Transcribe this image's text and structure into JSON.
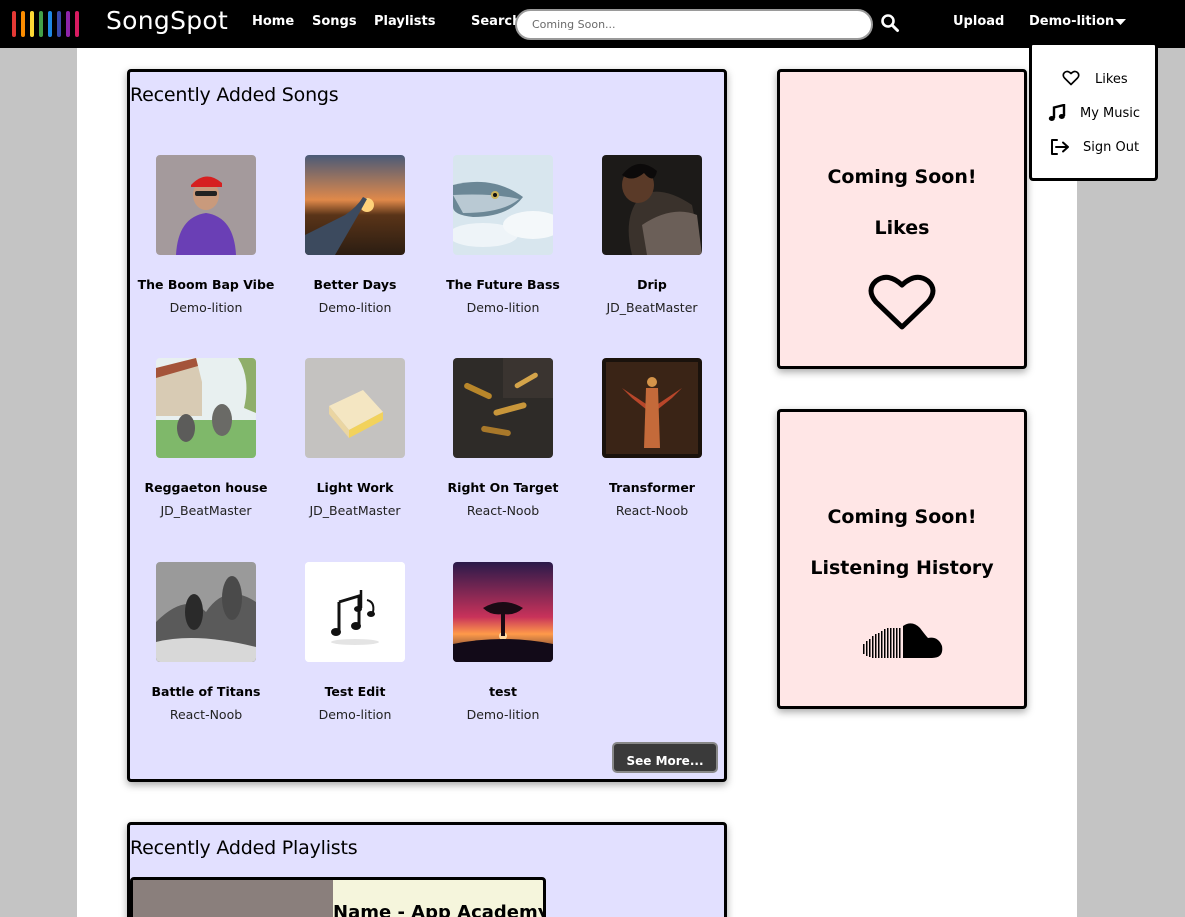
{
  "brand": {
    "name": "SongSpot",
    "logo_colors": [
      "#e53935",
      "#fb8c00",
      "#fdd835",
      "#43a047",
      "#1e88e5",
      "#3949ab",
      "#8e24aa",
      "#d81b60"
    ]
  },
  "nav": {
    "home": "Home",
    "songs": "Songs",
    "playlists": "Playlists",
    "search_label": "Search",
    "search_placeholder": "Coming Soon...",
    "upload": "Upload",
    "user": "Demo-lition"
  },
  "dropdown": {
    "items": [
      {
        "label": "Likes",
        "icon": "heart-icon"
      },
      {
        "label": "My Music",
        "icon": "music-note-icon"
      },
      {
        "label": "Sign Out",
        "icon": "sign-out-icon"
      }
    ]
  },
  "songs_panel": {
    "title": "Recently Added Songs",
    "see_more": "See More...",
    "songs": [
      {
        "title": "The Boom Bap Vibe",
        "artist": "Demo-lition"
      },
      {
        "title": "Better Days",
        "artist": "Demo-lition"
      },
      {
        "title": "The Future Bass",
        "artist": "Demo-lition"
      },
      {
        "title": "Drip",
        "artist": "JD_BeatMaster"
      },
      {
        "title": "Reggaeton house",
        "artist": "JD_BeatMaster"
      },
      {
        "title": "Light Work",
        "artist": "JD_BeatMaster"
      },
      {
        "title": "Right On Target",
        "artist": "React-Noob"
      },
      {
        "title": "Transformer",
        "artist": "React-Noob"
      },
      {
        "title": "Battle of Titans",
        "artist": "React-Noob"
      },
      {
        "title": "Test Edit",
        "artist": "Demo-lition"
      },
      {
        "title": "test",
        "artist": "Demo-lition"
      }
    ]
  },
  "playlists_panel": {
    "title": "Recently Added Playlists",
    "playlist_name": "Name - App Academy"
  },
  "likes_panel": {
    "line1": "Coming Soon!",
    "line2": "Likes",
    "icon": "heart-icon"
  },
  "history_panel": {
    "line1": "Coming Soon!",
    "line2": "Listening History",
    "icon": "soundcloud-icon"
  }
}
